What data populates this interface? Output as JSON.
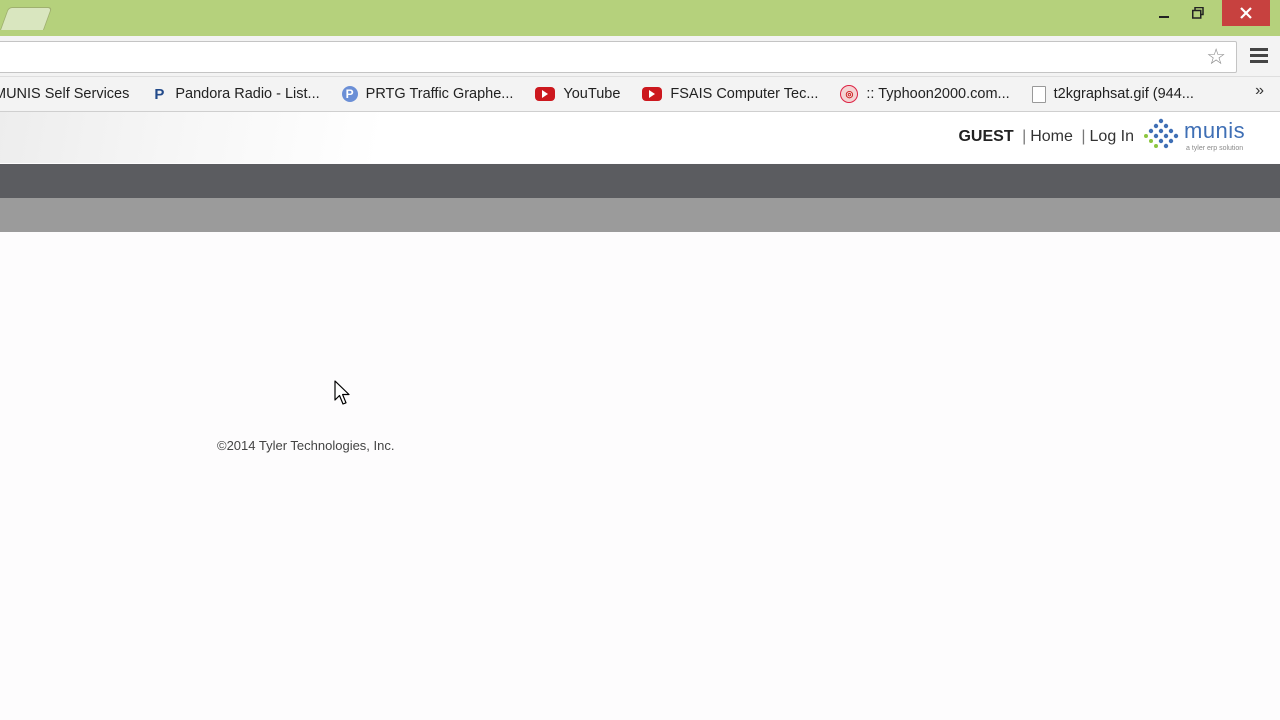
{
  "window": {
    "minimize_icon": "minimize-icon",
    "restore_icon": "restore-icon",
    "close_icon": "close-icon",
    "close_color": "#c7413f",
    "titlebar_color": "#b5d17c"
  },
  "toolbar": {
    "address_value": "",
    "star_icon": "star-icon",
    "menu_icon": "hamburger-menu-icon"
  },
  "bookmarks": [
    {
      "label": "MUNIS Self Services",
      "icon": "none"
    },
    {
      "label": "Pandora Radio - List...",
      "icon": "pandora-icon"
    },
    {
      "label": "PRTG Traffic Graphe...",
      "icon": "prtg-icon"
    },
    {
      "label": "YouTube",
      "icon": "youtube-icon"
    },
    {
      "label": "FSAIS Computer Tec...",
      "icon": "youtube-icon"
    },
    {
      "label": ":: Typhoon2000.com...",
      "icon": "typhoon-icon"
    },
    {
      "label": "t2kgraphsat.gif (944...",
      "icon": "document-icon"
    }
  ],
  "bookmarks_more": "»",
  "header": {
    "user": "GUEST",
    "sep1": "|",
    "home": "Home",
    "sep2": "|",
    "login": "Log In",
    "logo_word": "munis",
    "logo_tagline": "a tyler erp solution"
  },
  "nav": {
    "dark_color": "#5b5c60",
    "light_color": "#9b9b9b"
  },
  "footer": {
    "copyright": "©2014 Tyler Technologies, Inc."
  }
}
